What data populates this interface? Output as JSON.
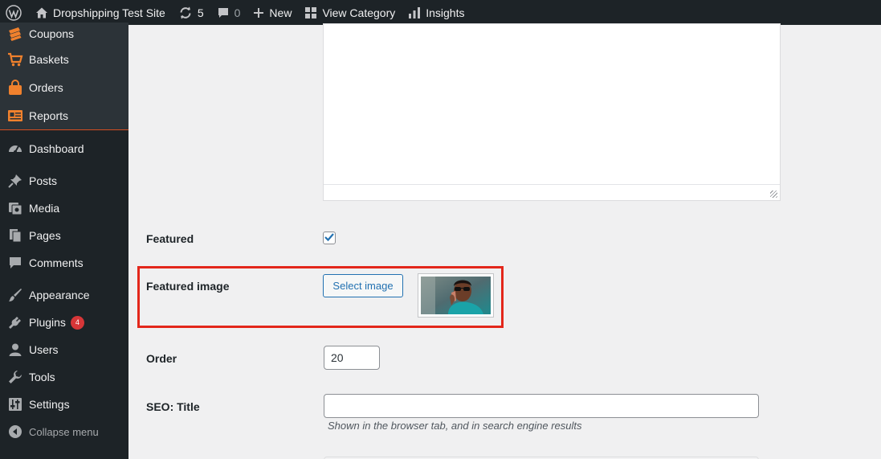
{
  "adminbar": {
    "site_name": "Dropshipping Test Site",
    "updates_count": "5",
    "comments_count": "0",
    "new_label": "New",
    "view_category_label": "View Category",
    "insights_label": "Insights",
    "icons": [
      "wordpress-logo-icon",
      "home-icon",
      "refresh-icon",
      "comment-icon",
      "plus-icon",
      "grid-icon",
      "bar-chart-icon"
    ]
  },
  "sidebar": {
    "woocommerce_items": [
      {
        "label": "Coupons",
        "icon": "coupon-icon"
      },
      {
        "label": "Baskets",
        "icon": "cart-icon"
      },
      {
        "label": "Orders",
        "icon": "bag-icon"
      },
      {
        "label": "Reports",
        "icon": "reports-icon"
      }
    ],
    "items": [
      {
        "label": "Dashboard",
        "icon": "dashboard-icon"
      },
      {
        "label": "Posts",
        "icon": "pin-icon"
      },
      {
        "label": "Media",
        "icon": "media-icon"
      },
      {
        "label": "Pages",
        "icon": "pages-icon"
      },
      {
        "label": "Comments",
        "icon": "comments-icon"
      },
      {
        "label": "Appearance",
        "icon": "brush-icon"
      },
      {
        "label": "Plugins",
        "icon": "plug-icon",
        "badge": "4"
      },
      {
        "label": "Users",
        "icon": "user-icon"
      },
      {
        "label": "Tools",
        "icon": "wrench-icon"
      },
      {
        "label": "Settings",
        "icon": "sliders-icon"
      }
    ],
    "collapse_label": "Collapse menu"
  },
  "form": {
    "featured_label": "Featured",
    "featured_checked": true,
    "featured_image_label": "Featured image",
    "select_image_label": "Select image",
    "order_label": "Order",
    "order_value": "20",
    "seo_title_label": "SEO: Title",
    "seo_title_value": "",
    "seo_title_help": "Shown in the browser tab, and in search engine results"
  },
  "colors": {
    "adminbar_bg": "#1d2327",
    "woo_accent": "#f0812d",
    "highlight": "#e3271b",
    "primary": "#2271b1",
    "badge": "#d63638"
  }
}
